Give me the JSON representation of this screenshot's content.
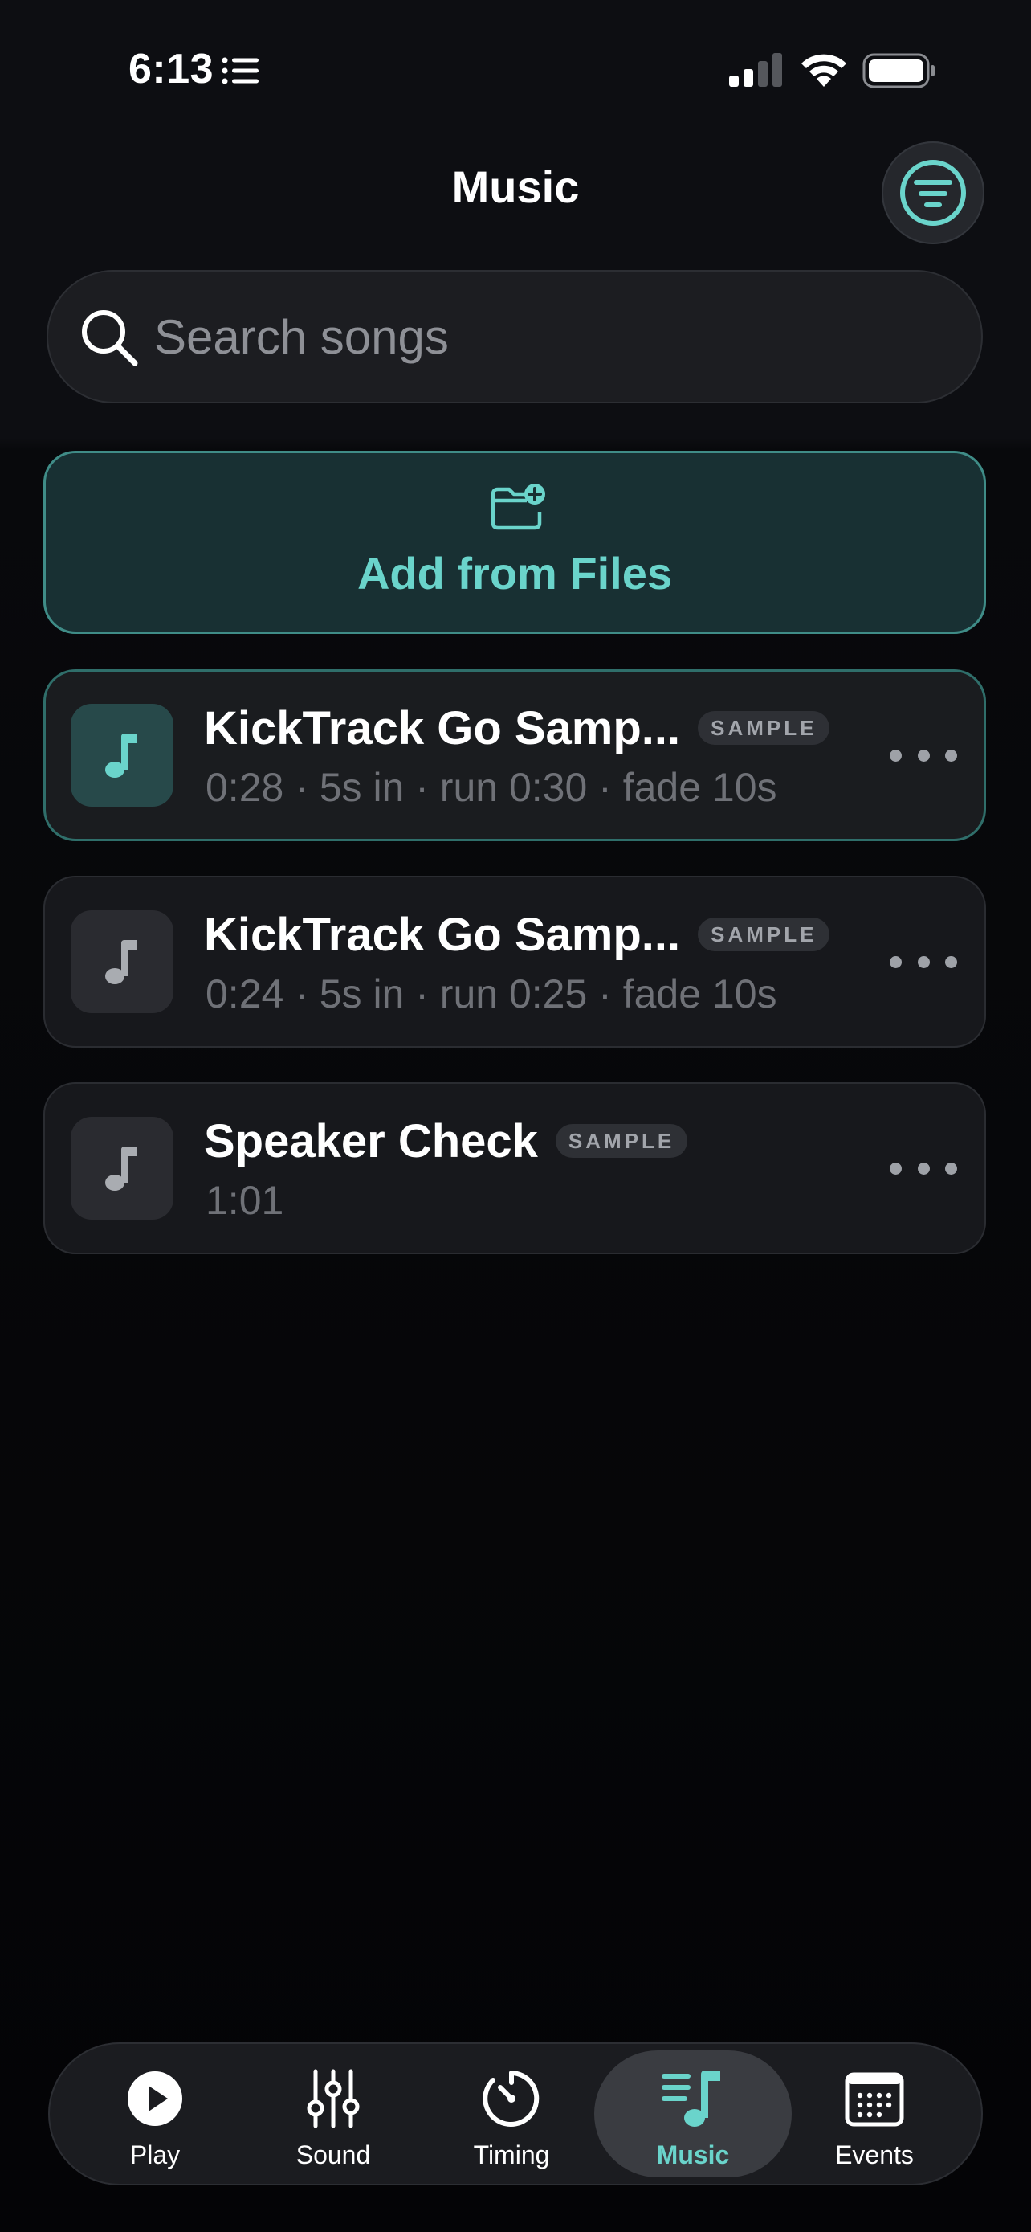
{
  "status_bar": {
    "time": "6:13"
  },
  "header": {
    "title": "Music",
    "filter_icon": "filter-lines-icon"
  },
  "search": {
    "placeholder": "Search songs",
    "value": ""
  },
  "add_files": {
    "label": "Add from Files",
    "icon": "folder-plus-icon"
  },
  "songs": [
    {
      "title": "KickTrack Go Samp...",
      "badge": "SAMPLE",
      "meta": "0:28 · 5s in · run 0:30 · fade 10s",
      "selected": true
    },
    {
      "title": "KickTrack Go Samp...",
      "badge": "SAMPLE",
      "meta": "0:24 · 5s in · run 0:25 · fade 10s",
      "selected": false
    },
    {
      "title": "Speaker Check",
      "badge": "SAMPLE",
      "meta": "1:01",
      "selected": false
    }
  ],
  "tabs": [
    {
      "label": "Play",
      "icon": "play-icon",
      "active": false
    },
    {
      "label": "Sound",
      "icon": "sliders-icon",
      "active": false
    },
    {
      "label": "Timing",
      "icon": "timer-icon",
      "active": false
    },
    {
      "label": "Music",
      "icon": "music-list-icon",
      "active": true
    },
    {
      "label": "Events",
      "icon": "calendar-icon",
      "active": false
    }
  ],
  "colors": {
    "accent": "#6ad4cb",
    "background": "#060608",
    "card": "#17181c",
    "muted_text": "#6f7177"
  }
}
